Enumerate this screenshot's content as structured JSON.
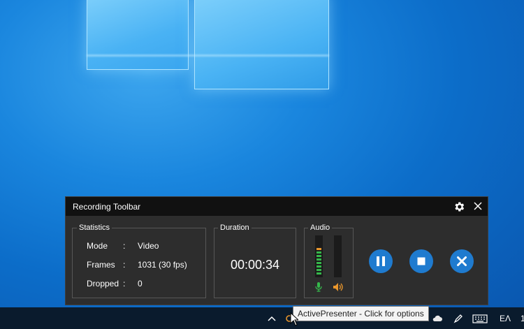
{
  "toolbar": {
    "title": "Recording Toolbar",
    "settings_icon": "gear-icon",
    "close_icon": "close-icon",
    "statistics": {
      "label": "Statistics",
      "rows": [
        {
          "label": "Mode",
          "colon": ":",
          "value": "Video"
        },
        {
          "label": "Frames",
          "colon": ":",
          "value": "1031 (30 fps)"
        },
        {
          "label": "Dropped",
          "colon": ":",
          "value": "0"
        }
      ]
    },
    "duration": {
      "label": "Duration",
      "value": "00:00:34"
    },
    "audio": {
      "label": "Audio",
      "mic_level": 0.7,
      "speaker_level": 0.0,
      "mic_icon": "microphone-icon",
      "speaker_icon": "speaker-icon"
    },
    "controls": {
      "pause_icon": "pause-icon",
      "stop_icon": "stop-icon",
      "cancel_icon": "cancel-icon"
    },
    "colors": {
      "accent": "#1f7bcf",
      "meter_green": "#35b84b",
      "meter_peak": "#e9962c"
    }
  },
  "taskbar": {
    "tooltip": "ActivePresenter - Click for options",
    "language": "ΕΛ",
    "clock": "1"
  }
}
